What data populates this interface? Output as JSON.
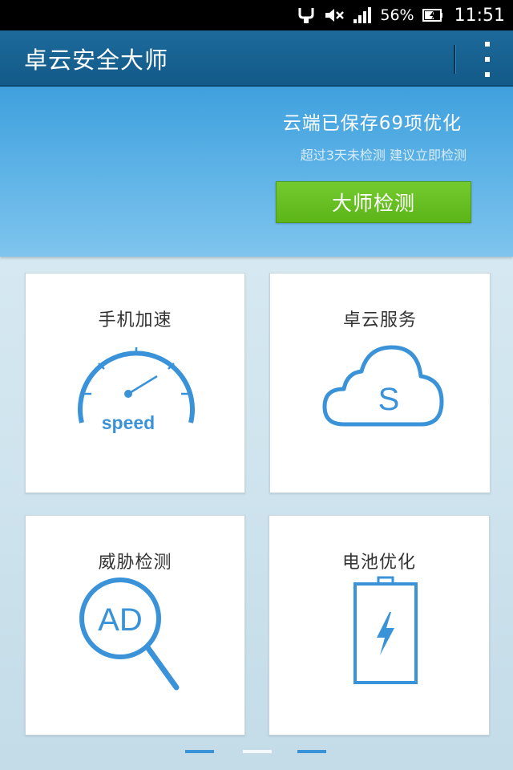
{
  "status_bar": {
    "battery_percent": "56%",
    "time": "11:51",
    "icons": [
      "usb-debug-icon",
      "mute-icon",
      "signal-icon",
      "battery-charging-icon"
    ]
  },
  "app_bar": {
    "title": "卓云安全大师",
    "menu_icon": "overflow-menu-icon"
  },
  "hero": {
    "title": "云端已保存69项优化",
    "subtitle": "超过3天未检测  建议立即检测",
    "button_label": "大师检测",
    "button_color": "#66bf22"
  },
  "cards": [
    {
      "title": "手机加速",
      "icon": "speedometer-icon",
      "icon_text": "speed"
    },
    {
      "title": "卓云服务",
      "icon": "cloud-service-icon",
      "icon_text": "S"
    },
    {
      "title": "威胁检测",
      "icon": "ad-magnifier-icon",
      "icon_text": "AD"
    },
    {
      "title": "电池优化",
      "icon": "battery-bolt-icon"
    }
  ],
  "pager": {
    "pages": 3,
    "current_page": 2
  },
  "colors": {
    "icon_blue": "#3a93d8",
    "appbar": "#135a88"
  }
}
